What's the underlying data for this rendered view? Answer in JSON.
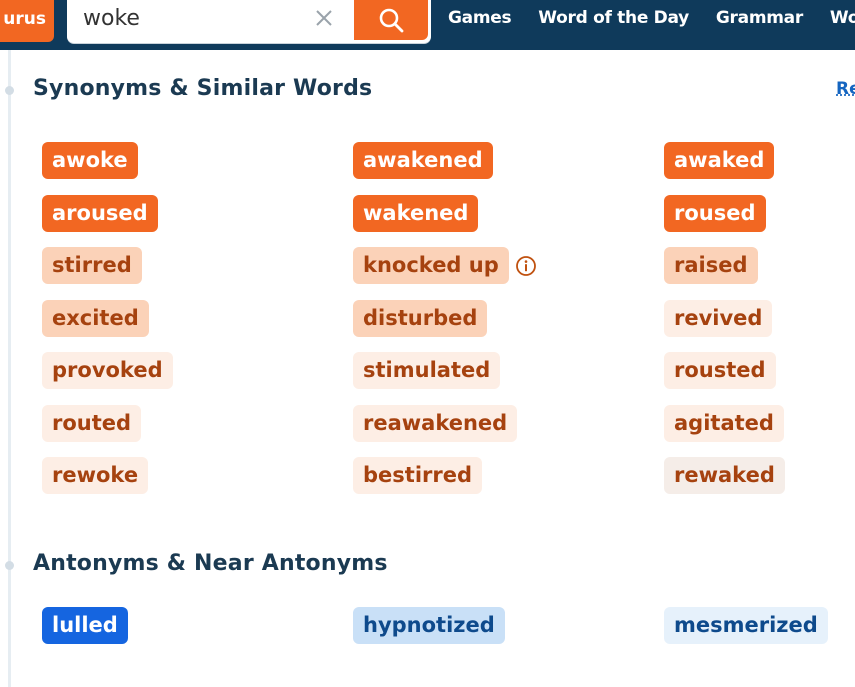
{
  "header": {
    "brand_fragment": "urus",
    "search": {
      "value": "woke",
      "placeholder": ""
    },
    "nav": [
      "Games",
      "Word of the Day",
      "Grammar",
      "Word"
    ]
  },
  "colors": {
    "nav_bg": "#0f3a5b",
    "accent": "#f26722",
    "syn_strong_bg": "#f26722",
    "syn_medium_bg": "#fbd2b8",
    "syn_light_bg": "#fdeee5",
    "syn_text_dark": "#a6420f",
    "ant_strong_bg": "#1565e0",
    "ant_medium_bg": "#c9e0f7",
    "ant_light_bg": "#e6f1fb",
    "ant_text_dark": "#0e4a8c"
  },
  "synonyms": {
    "title": "Synonyms & Similar Words",
    "related_link": "Re",
    "rows": [
      [
        {
          "word": "awoke",
          "level": "strong"
        },
        {
          "word": "awakened",
          "level": "strong"
        },
        {
          "word": "awaked",
          "level": "strong"
        }
      ],
      [
        {
          "word": "aroused",
          "level": "strong"
        },
        {
          "word": "wakened",
          "level": "strong"
        },
        {
          "word": "roused",
          "level": "strong"
        }
      ],
      [
        {
          "word": "stirred",
          "level": "medium"
        },
        {
          "word": "knocked up",
          "level": "medium",
          "info": true
        },
        {
          "word": "raised",
          "level": "medium"
        }
      ],
      [
        {
          "word": "excited",
          "level": "medium"
        },
        {
          "word": "disturbed",
          "level": "medium"
        },
        {
          "word": "revived",
          "level": "light"
        }
      ],
      [
        {
          "word": "provoked",
          "level": "light"
        },
        {
          "word": "stimulated",
          "level": "light"
        },
        {
          "word": "rousted",
          "level": "light"
        }
      ],
      [
        {
          "word": "routed",
          "level": "light"
        },
        {
          "word": "reawakened",
          "level": "light"
        },
        {
          "word": "agitated",
          "level": "light"
        }
      ],
      [
        {
          "word": "rewoke",
          "level": "light"
        },
        {
          "word": "bestirred",
          "level": "light"
        },
        {
          "word": "rewaked",
          "level": "faint"
        }
      ]
    ]
  },
  "antonyms": {
    "title": "Antonyms & Near Antonyms",
    "rows": [
      [
        {
          "word": "lulled",
          "level": "strong"
        },
        {
          "word": "hypnotized",
          "level": "medium"
        },
        {
          "word": "mesmerized",
          "level": "light"
        }
      ]
    ]
  }
}
